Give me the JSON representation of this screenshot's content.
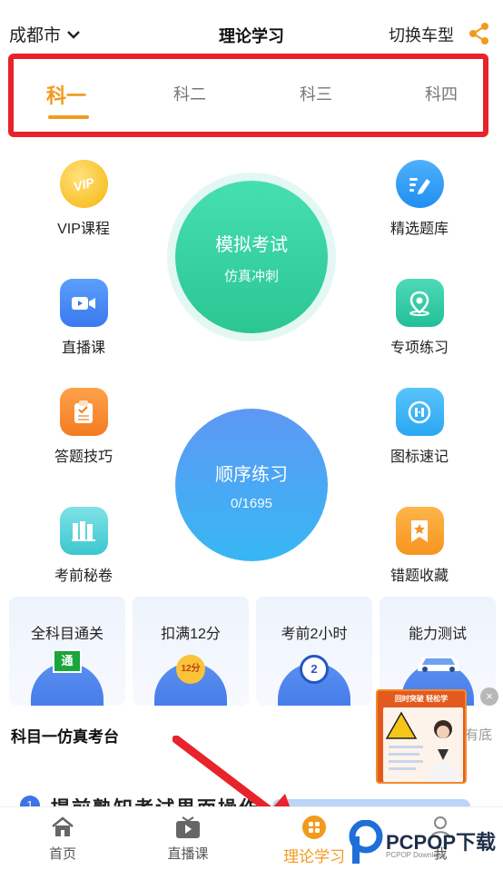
{
  "header": {
    "city": "成都市",
    "title": "理论学习",
    "switch_label": "切换车型"
  },
  "tabs": [
    {
      "label": "科一",
      "active": true
    },
    {
      "label": "科二",
      "active": false
    },
    {
      "label": "科三",
      "active": false
    },
    {
      "label": "科四",
      "active": false
    }
  ],
  "features": {
    "vip": "VIP课程",
    "vip_badge": "VIP",
    "question_bank": "精选题库",
    "live": "直播课",
    "special_practice": "专项练习",
    "tips": "答题技巧",
    "sign_memory": "图标速记",
    "exam_secret": "考前秘卷",
    "mistakes": "错题收藏"
  },
  "mock_exam": {
    "title": "模拟考试",
    "subtitle": "仿真冲刺"
  },
  "sequential": {
    "title": "顺序练习",
    "progress": "0/1695"
  },
  "cards": [
    {
      "label": "全科目通关",
      "badge": "通"
    },
    {
      "label": "扣满12分",
      "badge": "12分"
    },
    {
      "label": "考前2小时",
      "badge": "2"
    },
    {
      "label": "能力测试",
      "badge": ""
    }
  ],
  "section": {
    "title": "科目一仿真考台",
    "peek_number": "1",
    "peek_text": "提前熟知考试界面操作"
  },
  "popup": {
    "video_title": "回时突破  轻松学",
    "side_text": "有底",
    "close": "×"
  },
  "nav": [
    {
      "label": "首页",
      "icon": "home-icon"
    },
    {
      "label": "直播课",
      "icon": "play-icon"
    },
    {
      "label": "理论学习",
      "icon": "grid-icon",
      "active": true
    },
    {
      "label": "我",
      "icon": "user-icon"
    }
  ],
  "watermark": {
    "brand": "PCPOP下载",
    "sub": "PCPOP Download"
  },
  "colors": {
    "accent": "#f29a1c",
    "highlight_border": "#e8232b",
    "mock_green": "#3ed8a4",
    "seq_blue": "#4a9cf0"
  }
}
